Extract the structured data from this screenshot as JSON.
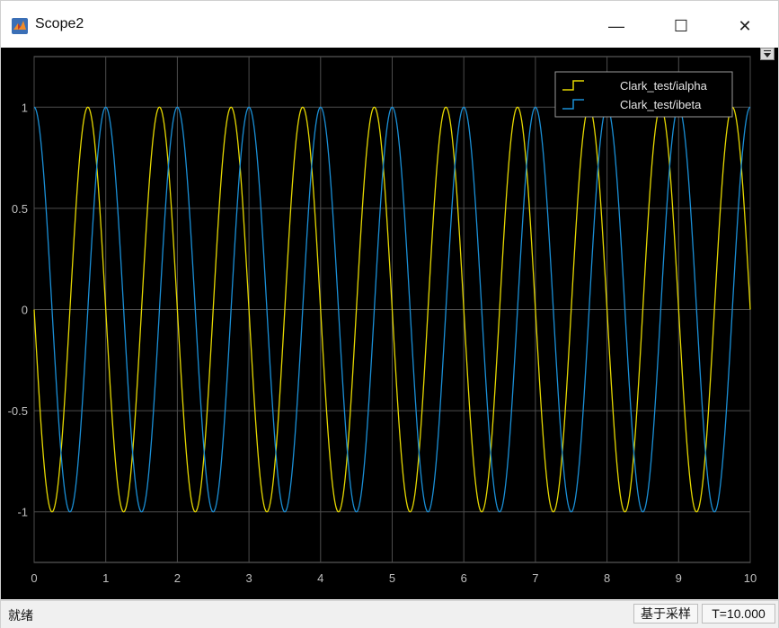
{
  "window": {
    "title": "Scope2",
    "minimize_glyph": "—",
    "maximize_glyph": "☐",
    "close_glyph": "✕",
    "app_icon": "matlab-icon"
  },
  "status": {
    "left_text": "就绪",
    "mode_text": "基于采样",
    "time_text": "T=10.000"
  },
  "colors": {
    "background": "#000000",
    "grid": "#4d4d4d",
    "axis_text": "#bfbfbf",
    "ialpha": "#e6d800",
    "ibeta": "#1a8fd6"
  },
  "chart_data": {
    "type": "line",
    "title": "",
    "xlabel": "",
    "ylabel": "",
    "xlim": [
      0,
      10
    ],
    "ylim": [
      -1.25,
      1.25
    ],
    "x_ticks": [
      0,
      1,
      2,
      3,
      4,
      5,
      6,
      7,
      8,
      9,
      10
    ],
    "x_tick_labels": [
      "0",
      "1",
      "2",
      "3",
      "4",
      "5",
      "6",
      "7",
      "8",
      "9",
      "10"
    ],
    "y_ticks": [
      1,
      0.5,
      0,
      -0.5,
      -1
    ],
    "y_tick_labels": [
      "1",
      "0.5",
      "0",
      "-0.5",
      "-1"
    ],
    "grid": true,
    "legend_position": "top-right",
    "frequency_hz": 1,
    "series": [
      {
        "name": "Clark_test/ialpha",
        "function": "-sin(2*pi*f*t)",
        "color": "#e6d800"
      },
      {
        "name": "Clark_test/ibeta",
        "function": "cos(2*pi*f*t)",
        "color": "#1a8fd6"
      }
    ]
  }
}
